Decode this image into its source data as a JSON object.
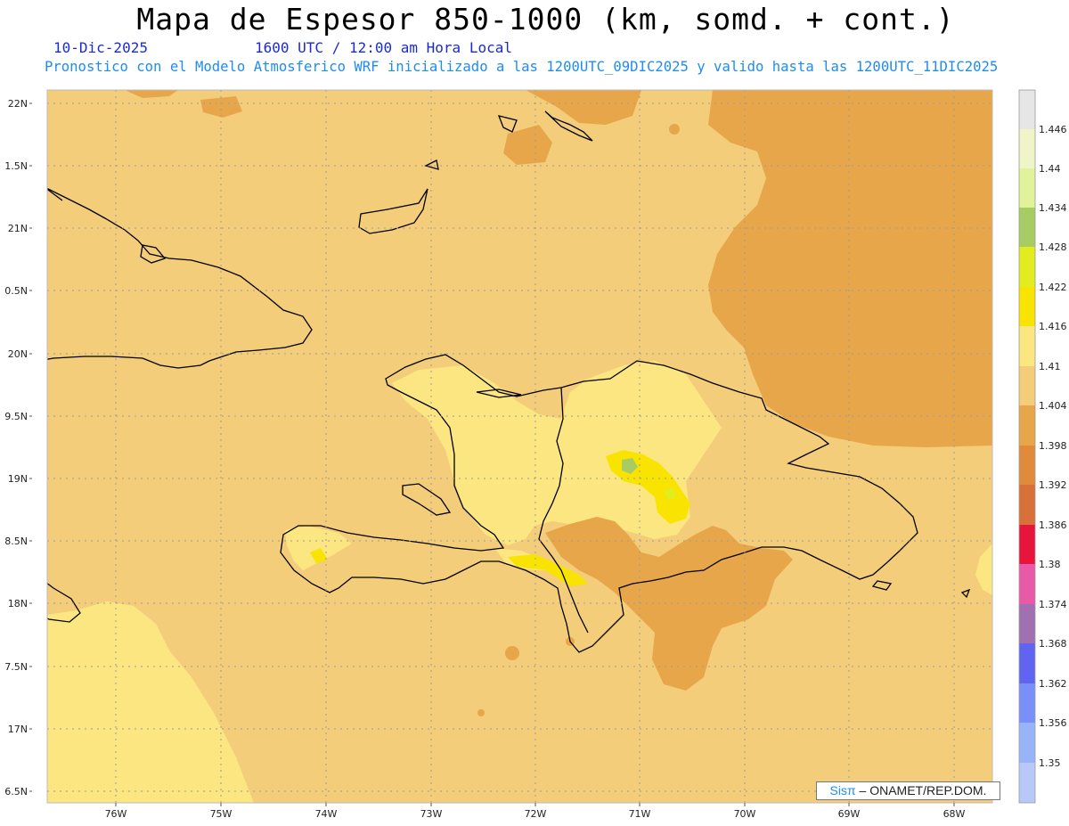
{
  "header": {
    "title": "Mapa de Espesor 850-1000 (km, somd. + cont.)",
    "date": "10-Dic-2025",
    "time": "1600 UTC / 12:00 am Hora Local",
    "description": "Pronostico con el Modelo Atmosferico WRF inicializado a las 1200UTC_09DIC2025 y valido hasta las  1200UTC_11DIC2025"
  },
  "map": {
    "lat_labels": [
      "22N",
      "1.5N",
      "21N",
      "0.5N",
      "20N",
      "9.5N",
      "19N",
      "8.5N",
      "18N",
      "7.5N",
      "17N",
      "6.5N"
    ],
    "lon_labels": [
      "76W",
      "75W",
      "74W",
      "73W",
      "72W",
      "71W",
      "70W",
      "69W",
      "68W"
    ],
    "region": "Hispaniola and surrounding Caribbean",
    "background_level": 1.404
  },
  "legend": {
    "levels": [
      "1.446",
      "1.44",
      "1.434",
      "1.428",
      "1.422",
      "1.416",
      "1.41",
      "1.404",
      "1.398",
      "1.392",
      "1.386",
      "1.38",
      "1.374",
      "1.368",
      "1.362",
      "1.356",
      "1.35"
    ],
    "colors": [
      "#e6e6e6",
      "#eff5c8",
      "#e0f29a",
      "#a8cc64",
      "#e2ec1e",
      "#f8e400",
      "#fbe682",
      "#f3cd7a",
      "#e8a64a",
      "#e08a3c",
      "#d8703a",
      "#e8143c",
      "#e85aa8",
      "#a070b0",
      "#6064f0",
      "#7890f8",
      "#98b4f8",
      "#b8c8f8"
    ]
  },
  "footer": {
    "sis": "Sisπ",
    "text": " – ONAMET/REP.DOM."
  }
}
